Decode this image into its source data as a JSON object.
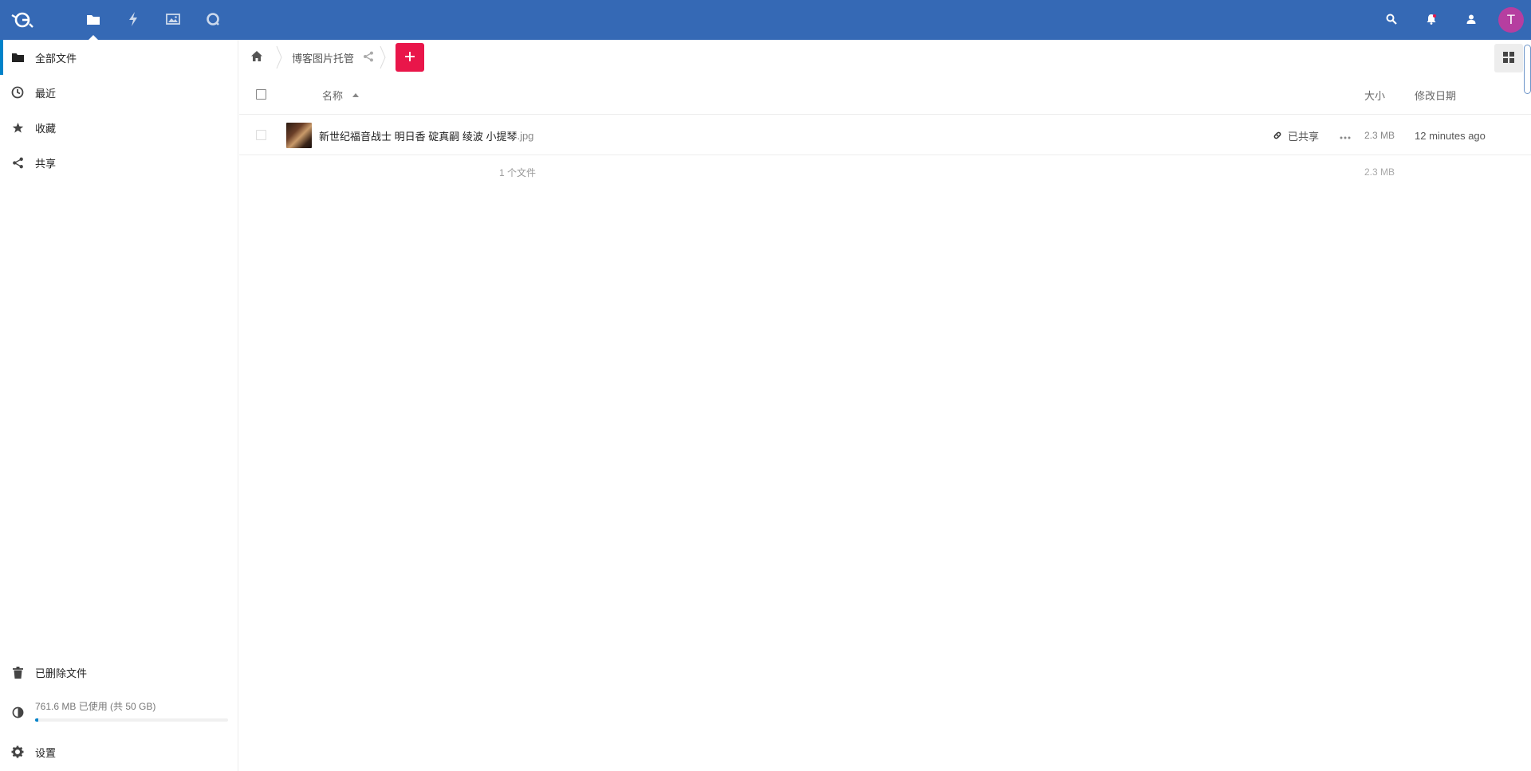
{
  "colors": {
    "brand": "#3569b5",
    "primary": "#0082c9",
    "add_button": "#e9164a",
    "avatar": "#b63ea0"
  },
  "header": {
    "logo_icon": "nextcloud-logo-icon",
    "apps": [
      {
        "name": "files",
        "icon": "folder-icon",
        "active": true
      },
      {
        "name": "activity",
        "icon": "lightning-icon",
        "active": false
      },
      {
        "name": "gallery",
        "icon": "image-icon",
        "active": false
      },
      {
        "name": "talk",
        "icon": "talk-icon",
        "active": false
      }
    ],
    "avatar_letter": "T"
  },
  "sidebar": {
    "items": [
      {
        "label": "全部文件",
        "icon": "folder-icon",
        "active": true
      },
      {
        "label": "最近",
        "icon": "clock-icon",
        "active": false
      },
      {
        "label": "收藏",
        "icon": "star-icon",
        "active": false
      },
      {
        "label": "共享",
        "icon": "share-icon",
        "active": false
      }
    ],
    "deleted_label": "已删除文件",
    "quota_text": "761.6 MB 已使用 (共 50 GB)",
    "quota_fraction": 0.015,
    "settings_label": "设置"
  },
  "breadcrumb": {
    "folder": "博客图片托管"
  },
  "table": {
    "headers": {
      "name": "名称",
      "size": "大小",
      "modified": "修改日期"
    },
    "files": [
      {
        "name": "新世纪福音战士 明日香 碇真嗣 绫波 小提琴",
        "ext": ".jpg",
        "shared_label": "已共享",
        "size": "2.3 MB",
        "modified": "12 minutes ago"
      }
    ],
    "summary": {
      "count": "1 个文件",
      "size": "2.3 MB"
    }
  }
}
